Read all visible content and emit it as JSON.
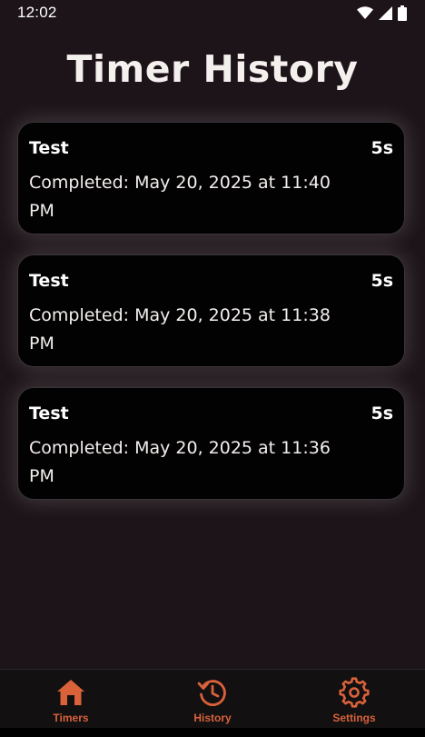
{
  "status_bar": {
    "time": "12:02",
    "icons": [
      "wifi-icon",
      "cell-signal-icon",
      "battery-icon"
    ]
  },
  "page": {
    "title": "Timer History"
  },
  "history": [
    {
      "name": "Test",
      "duration": "5s",
      "completed": "Completed: May 20, 2025 at 11:40 PM"
    },
    {
      "name": "Test",
      "duration": "5s",
      "completed": "Completed: May 20, 2025 at 11:38 PM"
    },
    {
      "name": "Test",
      "duration": "5s",
      "completed": "Completed: May 20, 2025 at 11:36 PM"
    }
  ],
  "nav": {
    "items": [
      {
        "label": "Timers",
        "icon": "home-icon"
      },
      {
        "label": "History",
        "icon": "history-icon"
      },
      {
        "label": "Settings",
        "icon": "gear-icon"
      }
    ]
  },
  "colors": {
    "background": "#1c1418",
    "card": "#030203",
    "accent": "#d9623b",
    "nav_background": "#121011"
  }
}
